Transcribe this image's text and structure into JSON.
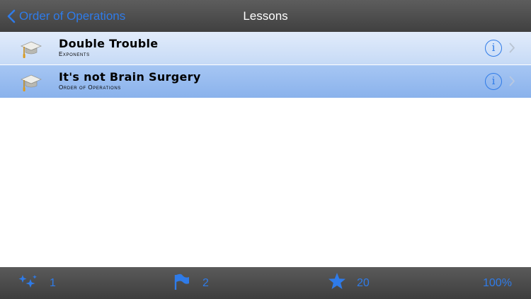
{
  "navbar": {
    "back_label": "Order of Operations",
    "title": "Lessons",
    "back_icon": "chevron-left-icon"
  },
  "lessons": [
    {
      "title": "Double Trouble",
      "subtitle": "Exponents",
      "icon": "graduation-cap-icon",
      "selected": false
    },
    {
      "title": "It's not Brain Surgery",
      "subtitle": "Order of Operations",
      "icon": "graduation-cap-icon",
      "selected": true
    }
  ],
  "toolbar": {
    "tips_count": "1",
    "flags_count": "2",
    "stars_count": "20",
    "percent": "100%"
  },
  "colors": {
    "accent": "#2f7be8",
    "bar": "#4a4a4a",
    "row_light": "#d4e3f8",
    "row_selected": "#8ab2ec"
  }
}
